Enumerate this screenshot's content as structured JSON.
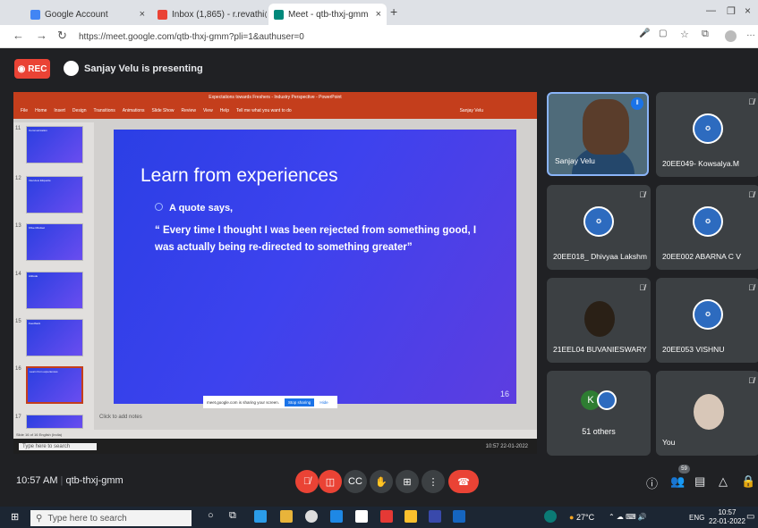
{
  "browser": {
    "tabs": [
      {
        "title": "Google Account"
      },
      {
        "title": "Inbox (1,865) - r.revathi@kpriet.ac"
      },
      {
        "title": "Meet - qtb-thxj-gmm"
      }
    ],
    "new_tab": "+",
    "url": "https://meet.google.com/qtb-thxj-gmm?pli=1&authuser=0"
  },
  "meet": {
    "rec_label": "REC",
    "presenter_label": "Sanjay Velu is presenting",
    "meeting_time": "10:57 AM",
    "meeting_code": "qtb-thxj-gmm",
    "people_count": "59"
  },
  "ppt": {
    "title_bar": "Expectations towards Freshers - Industry Perspective - PowerPoint",
    "ribbon_tabs": [
      "File",
      "Home",
      "Insert",
      "Design",
      "Transitions",
      "Animations",
      "Slide Show",
      "Review",
      "View",
      "Help",
      "Tell me what you want to do"
    ],
    "user": "Sanjay Velu",
    "thumb_numbers": [
      "11",
      "12",
      "13",
      "14",
      "15",
      "16",
      "17"
    ],
    "thumb_titles": [
      "Communication",
      "Interview Etiquette",
      "Kfive Mindset",
      "Attitude",
      "Feedback",
      "Learn from experiences",
      ""
    ],
    "slide": {
      "title": "Learn from experiences",
      "quote_intro": "A quote says,",
      "quote": "“ Every time I thought I was been rejected from something good, I was actually being re-directed to something greater”",
      "number": "16"
    },
    "share_banner": "meet.google.com is sharing your screen.",
    "stop_sharing": "Stop sharing",
    "hide": "Hide",
    "notes": "Click to add notes",
    "status": "Slide 16 of 16   English (India)",
    "inner_search": "Type here to search",
    "inner_clock": "10:57 22-01-2022"
  },
  "participants": [
    {
      "name": "Sanjay Velu"
    },
    {
      "name": "20EE049- Kowsalya.M"
    },
    {
      "name": "20EE018_ Dhivyaa Lakshm..."
    },
    {
      "name": "20EE002 ABARNA C V"
    },
    {
      "name": "21EEL04 BUVANIESWARY ..."
    },
    {
      "name": "20EE053 VISHNU"
    },
    {
      "name": "51 others",
      "initial": "K"
    },
    {
      "name": "You"
    }
  ],
  "taskbar": {
    "search": "Type here to search",
    "weather": "27°C",
    "lang": "ENG",
    "time": "10:57",
    "date": "22-01-2022"
  },
  "colors": {
    "accent": "#1a73e8",
    "end_call": "#ea4335",
    "ppt": "#c43e1c"
  }
}
